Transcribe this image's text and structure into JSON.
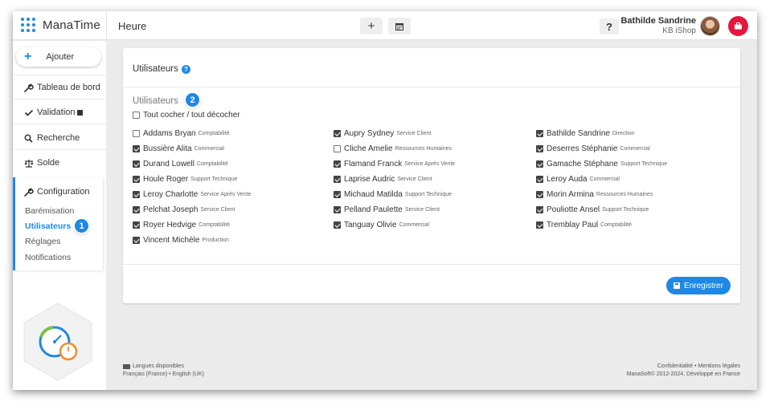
{
  "app": {
    "name": "ManaTime"
  },
  "header": {
    "page_title": "Heure",
    "help_label": "?",
    "user_name": "Bathilde Sandrine",
    "user_company": "KB iShop"
  },
  "sidebar": {
    "add_label": "Ajouter",
    "items": [
      {
        "label": "Tableau de bord",
        "icon": "wrench-icon"
      },
      {
        "label": "Validation",
        "icon": "check-icon"
      },
      {
        "label": "Recherche",
        "icon": "search-icon"
      },
      {
        "label": "Solde",
        "icon": "balance-icon"
      }
    ],
    "config": {
      "title": "Configuration",
      "items": [
        "Barémisation",
        "Utilisateurs",
        "Réglages",
        "Notifications"
      ],
      "active": "Utilisateurs"
    }
  },
  "badges": {
    "one": "1",
    "two": "2"
  },
  "panel": {
    "heading": "Utilisateurs",
    "section_title": "Utilisateurs",
    "toggle_all_label": "Tout cocher / tout décocher",
    "save_label": "Enregistrer"
  },
  "users": [
    {
      "name": "Addams Bryan",
      "dept": "Comptabilité",
      "checked": false
    },
    {
      "name": "Aupry Sydney",
      "dept": "Service Client",
      "checked": true
    },
    {
      "name": "Bathilde Sandrine",
      "dept": "Direction",
      "checked": true
    },
    {
      "name": "Bussière Alita",
      "dept": "Commercial",
      "checked": true
    },
    {
      "name": "Cliche Amelie",
      "dept": "Ressources Humaines",
      "checked": false
    },
    {
      "name": "Deserres Stéphanie",
      "dept": "Commercial",
      "checked": true
    },
    {
      "name": "Durand Lowell",
      "dept": "Comptabilité",
      "checked": true
    },
    {
      "name": "Flamand Franck",
      "dept": "Service Après Vente",
      "checked": true
    },
    {
      "name": "Gamache Stéphane",
      "dept": "Support Technique",
      "checked": true
    },
    {
      "name": "Houle Roger",
      "dept": "Support Technique",
      "checked": true
    },
    {
      "name": "Laprise Audric",
      "dept": "Service Client",
      "checked": true
    },
    {
      "name": "Leroy Auda",
      "dept": "Commercial",
      "checked": true
    },
    {
      "name": "Leroy Charlotte",
      "dept": "Service Après Vente",
      "checked": true
    },
    {
      "name": "Michaud Matilda",
      "dept": "Support Technique",
      "checked": true
    },
    {
      "name": "Morin Armina",
      "dept": "Ressources Humaines",
      "checked": true
    },
    {
      "name": "Pelchat Joseph",
      "dept": "Service Client",
      "checked": true
    },
    {
      "name": "Pelland Paulette",
      "dept": "Service Client",
      "checked": true
    },
    {
      "name": "Pouliotte Ansel",
      "dept": "Support Technique",
      "checked": true
    },
    {
      "name": "Royer Hedvige",
      "dept": "Comptabilité",
      "checked": true
    },
    {
      "name": "Tanguay Olivie",
      "dept": "Commercial",
      "checked": true
    },
    {
      "name": "Tremblay Paul",
      "dept": "Comptabilité",
      "checked": true
    },
    {
      "name": "Vincent Michèle",
      "dept": "Production",
      "checked": true
    }
  ],
  "footer": {
    "languages_title": "Langues disponibles",
    "languages": "Français (France) • English (UK)",
    "links": "Confidentialité • Mentions légales",
    "copyright": "ManaSoft© 2012-2024, Développé en France"
  },
  "colors": {
    "accent": "#1e88e5",
    "alert": "#e5173f"
  }
}
